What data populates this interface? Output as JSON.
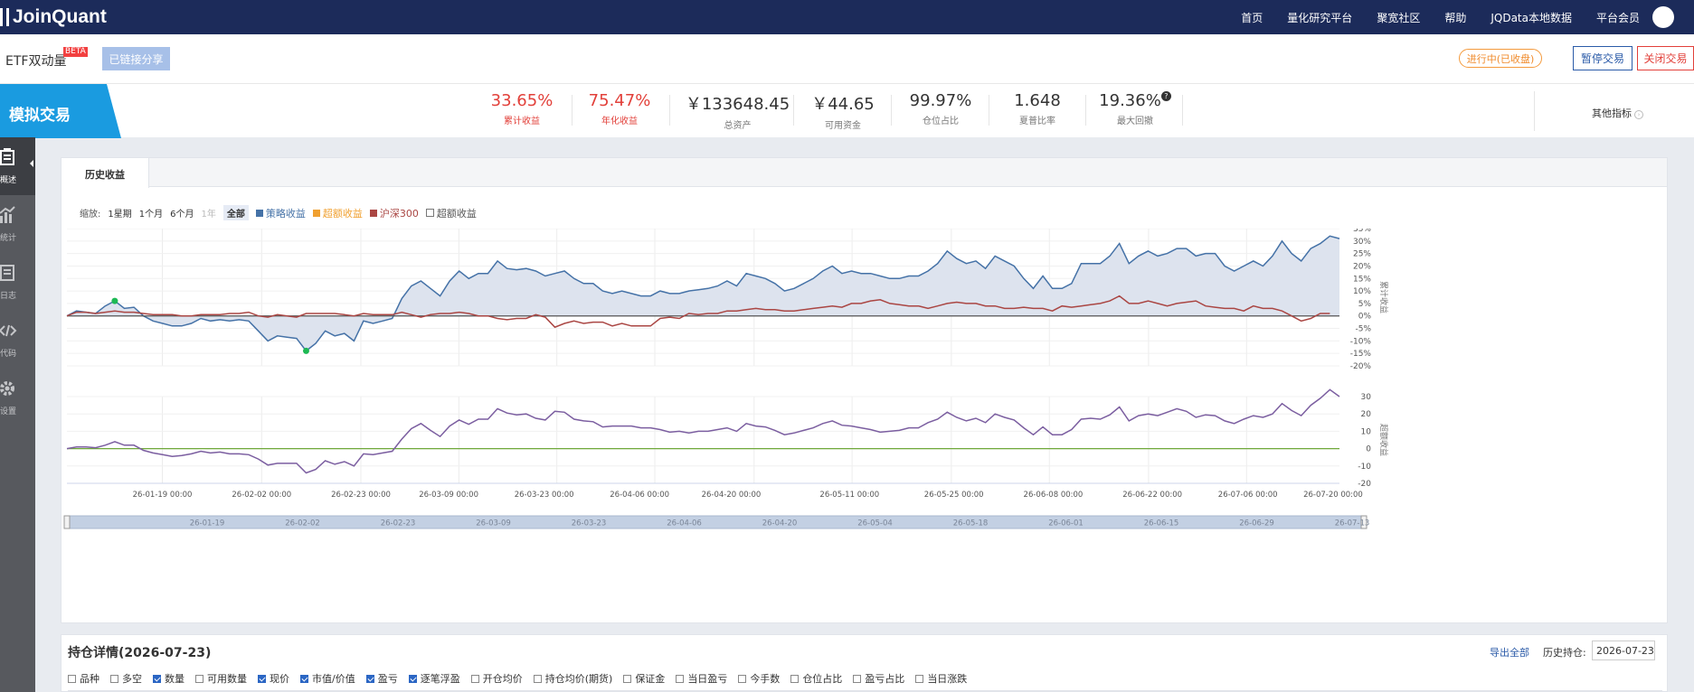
{
  "topnav": {
    "brand": "JoinQuant",
    "links": [
      "首页",
      "量化研究平台",
      "聚宽社区",
      "帮助",
      "JQData本地数据",
      "平台会员"
    ]
  },
  "strategy": {
    "name": "ETF双动量",
    "beta": "BETA",
    "share_label": "已链接分享",
    "status": "进行中(已收盘)",
    "pause_label": "暂停交易",
    "close_label": "关闭交易"
  },
  "metrics": {
    "tab_label": "模拟交易",
    "items": [
      {
        "value": "33.65%",
        "label": "累计收益"
      },
      {
        "value": "75.47%",
        "label": "年化收益"
      },
      {
        "value": "￥133648.45",
        "label": "总资产"
      },
      {
        "value": "￥44.65",
        "label": "可用资金"
      },
      {
        "value": "99.97%",
        "label": "仓位占比"
      },
      {
        "value": "1.648",
        "label": "夏普比率"
      },
      {
        "value": "19.36%",
        "label": "最大回撤"
      }
    ],
    "other_label": "其他指标"
  },
  "sidebar": {
    "items": [
      {
        "label": "概述",
        "icon": "overview-icon"
      },
      {
        "label": "统计",
        "icon": "stats-icon"
      },
      {
        "label": "日志",
        "icon": "log-icon"
      },
      {
        "label": "代码",
        "icon": "code-icon"
      },
      {
        "label": "设置",
        "icon": "settings-icon"
      }
    ]
  },
  "chart_panel": {
    "tab": "历史收益",
    "zoom_label": "缩放:",
    "zoom_options": [
      "1星期",
      "1个月",
      "6个月",
      "1年",
      "全部"
    ],
    "legend": [
      {
        "name": "策略收益",
        "color": "#4572a7"
      },
      {
        "name": "超额收益",
        "color": "#f0a030"
      },
      {
        "name": "沪深300",
        "color": "#aa4643"
      },
      {
        "name": "超额收益",
        "color": "#333333"
      }
    ]
  },
  "chart_data": [
    {
      "type": "line",
      "ylabel": "累计收益",
      "ylim": [
        -20,
        35
      ],
      "yticks": [
        "35%",
        "30%",
        "25%",
        "20%",
        "15%",
        "10%",
        "5%",
        "0%",
        "-5%",
        "-10%",
        "-15%",
        "-20%"
      ],
      "x_labels": [
        "26-01-19 00:00",
        "26-02-02 00:00",
        "26-02-23 00:00",
        "26-03-09 00:00",
        "26-03-23 00:00",
        "26-04-06 00:00",
        "26-04-20 00:00",
        "26-05-11 00:00",
        "26-05-25 00:00",
        "26-06-08 00:00",
        "26-06-22 00:00",
        "26-07-06 00:00",
        "26-07-20 00:00"
      ],
      "series": [
        {
          "name": "策略收益",
          "color": "#4572a7",
          "values": [
            0,
            2,
            1.5,
            1,
            4,
            6,
            3,
            3.5,
            0,
            -2,
            -3,
            -4,
            -4,
            -3,
            -1,
            -2,
            -1.5,
            -2,
            -1.5,
            -2,
            -6,
            -10,
            -8,
            -8.5,
            -9,
            -14,
            -11,
            -6,
            -8,
            -7,
            -10,
            -2,
            -3,
            -2,
            -1,
            7,
            12,
            14,
            11,
            8,
            14,
            18,
            15,
            17,
            17,
            22,
            19,
            18.5,
            19,
            18,
            16,
            17,
            18,
            15,
            13,
            13,
            10,
            9,
            10,
            9,
            8,
            8,
            10,
            9,
            9,
            10,
            10.5,
            11,
            12,
            14,
            12,
            17,
            16,
            15,
            13,
            10,
            11,
            13,
            15,
            18,
            20,
            17,
            18,
            17,
            17,
            16,
            15,
            15,
            16,
            16,
            18,
            21,
            26,
            23,
            21,
            22,
            19,
            24,
            22,
            20,
            15,
            11,
            16,
            11,
            11,
            13,
            21,
            21,
            21,
            24,
            29,
            21,
            24,
            26,
            24,
            25,
            27,
            27,
            24,
            25,
            25,
            20,
            18,
            20,
            22,
            20,
            24,
            30,
            25,
            22,
            27,
            29,
            32,
            31
          ]
        },
        {
          "name": "沪深300",
          "color": "#aa4643",
          "values": [
            0,
            1.5,
            1.5,
            1,
            1.5,
            2,
            1.5,
            1.5,
            1,
            0.5,
            0.5,
            0.5,
            0,
            0,
            0.5,
            0.5,
            0.5,
            1,
            1,
            1.5,
            0,
            -0.5,
            0.5,
            0,
            -0.5,
            1,
            1,
            1,
            1,
            0.5,
            0,
            1,
            0.5,
            0.5,
            0.5,
            1.5,
            0.5,
            -0.5,
            0.5,
            1,
            1,
            1.5,
            1,
            0,
            0,
            -1,
            -1.5,
            -1,
            -1,
            0.5,
            -0.5,
            -4.5,
            -3,
            -2,
            -3,
            -2.5,
            -2.5,
            -4,
            -3,
            -4,
            -4,
            -4,
            -1,
            -0.5,
            -1,
            1,
            0.5,
            1,
            1,
            2,
            2,
            2.5,
            3,
            2.5,
            2.5,
            2,
            2,
            2.5,
            3,
            3.5,
            4,
            3.5,
            5,
            5,
            6,
            6.5,
            5,
            4.5,
            4,
            4,
            3,
            4,
            5,
            5.5,
            5,
            5,
            4,
            4,
            3,
            3,
            3.5,
            3,
            3,
            2,
            4,
            3.5,
            4,
            4.5,
            5,
            6,
            8,
            5,
            5,
            6,
            5,
            4,
            5,
            5.5,
            6,
            4,
            3.5,
            3,
            3,
            2,
            4,
            3,
            3,
            2,
            0,
            -2,
            -1,
            1,
            1
          ]
        }
      ]
    },
    {
      "type": "line",
      "ylabel": "超额收益",
      "ylim": [
        -20,
        30
      ],
      "yticks": [
        "30",
        "20",
        "10",
        "0",
        "-10",
        "-20"
      ],
      "series": [
        {
          "name": "超额收益",
          "color": "#7b5ea0",
          "values": [
            0,
            1,
            1,
            0.5,
            2,
            4,
            2,
            2,
            -1,
            -2.5,
            -3.5,
            -4.5,
            -4,
            -3,
            -1.5,
            -2.5,
            -2,
            -3,
            -3,
            -3.5,
            -6,
            -9.5,
            -8.5,
            -8.5,
            -8.5,
            -14,
            -12,
            -7,
            -9,
            -7.5,
            -10,
            -3,
            -3.5,
            -2.5,
            -1.5,
            5.5,
            11.5,
            14.5,
            10.5,
            7,
            13,
            16.5,
            14,
            17,
            17,
            23,
            20.5,
            19.5,
            20,
            17.5,
            16.5,
            21.5,
            21,
            17,
            16,
            15.5,
            12.5,
            13,
            13,
            13,
            12,
            12,
            11,
            9.5,
            10,
            9,
            10,
            10,
            11,
            12,
            10,
            14.5,
            13,
            12.5,
            10.5,
            8,
            9,
            10.5,
            12,
            14.5,
            16,
            13.5,
            13,
            12,
            11,
            9.5,
            10,
            10.5,
            12,
            12,
            15,
            17,
            21,
            18,
            16,
            17.5,
            15,
            20,
            18,
            16.5,
            12,
            8,
            12.5,
            8,
            8,
            11,
            17,
            17.5,
            17,
            19.5,
            24,
            16,
            19,
            20,
            19,
            21,
            23,
            21.5,
            18,
            19.5,
            19,
            16,
            14.5,
            17,
            19,
            18,
            20,
            26,
            22,
            19,
            25,
            29,
            34,
            30
          ]
        }
      ]
    }
  ],
  "navigator": {
    "labels": [
      "26-01-19",
      "26-02-02",
      "26-02-23",
      "26-03-09",
      "26-03-23",
      "26-04-06",
      "26-04-20",
      "26-05-04",
      "26-05-18",
      "26-06-01",
      "26-06-15",
      "26-06-29",
      "26-07-13"
    ]
  },
  "holdings": {
    "title": "持仓详情(2026-07-23)",
    "export_label": "导出全部",
    "history_label": "历史持仓:",
    "date_value": "2026-07-23",
    "columns": [
      {
        "label": "品种",
        "checked": false
      },
      {
        "label": "多空",
        "checked": false
      },
      {
        "label": "数量",
        "checked": true
      },
      {
        "label": "可用数量",
        "checked": false
      },
      {
        "label": "现价",
        "checked": true
      },
      {
        "label": "市值/价值",
        "checked": true
      },
      {
        "label": "盈亏",
        "checked": true
      },
      {
        "label": "逐笔浮盈",
        "checked": true
      },
      {
        "label": "开仓均价",
        "checked": false
      },
      {
        "label": "持仓均价(期货)",
        "checked": false
      },
      {
        "label": "保证金",
        "checked": false
      },
      {
        "label": "当日盈亏",
        "checked": false
      },
      {
        "label": "今手数",
        "checked": false
      },
      {
        "label": "仓位占比",
        "checked": false
      },
      {
        "label": "盈亏占比",
        "checked": false
      },
      {
        "label": "当日涨跌",
        "checked": false
      }
    ]
  }
}
